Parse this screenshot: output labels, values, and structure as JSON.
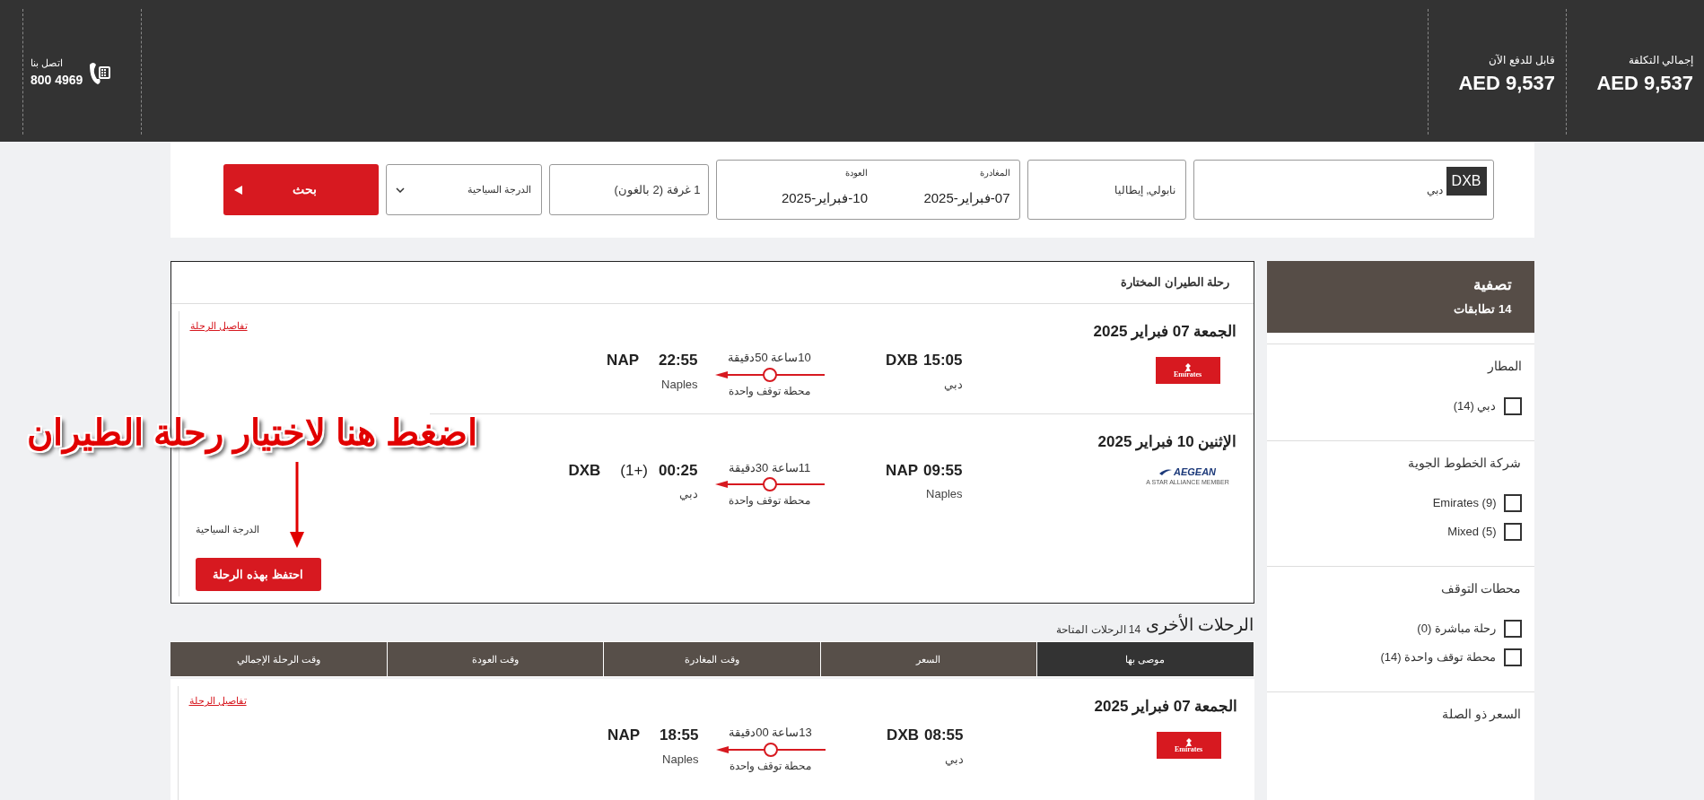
{
  "header": {
    "contact": {
      "label": "اتصل بنا",
      "phone": "800 4969"
    },
    "totals": [
      {
        "label": "إجمالي التكلفة",
        "amount": "AED 9,537"
      },
      {
        "label": "قابل للدفع الآن",
        "amount": "AED 9,537"
      }
    ]
  },
  "search": {
    "origin": {
      "code": "DXB",
      "city": "دبي"
    },
    "destination": "نابولي, إيطاليا",
    "departure": {
      "label": "المغادرة",
      "value": "07-فبراير-2025"
    },
    "return": {
      "label": "العودة",
      "value": "10-فبراير-2025"
    },
    "rooms": "1 غرفة (2 بالغون)",
    "cabin": "الدرجة السياحية",
    "button": "بحث"
  },
  "filters": {
    "title": "تصفية",
    "matches": "14 تطابقات",
    "sections": [
      {
        "title": "المطار",
        "options": [
          {
            "label": "دبي (14)",
            "checked": false
          }
        ]
      },
      {
        "title": "شركة الخطوط الجوية",
        "options": [
          {
            "label": "Emirates (9)",
            "checked": false
          },
          {
            "label": "Mixed (5)",
            "checked": false
          }
        ]
      },
      {
        "title": "محطات التوقف",
        "options": [
          {
            "label": "رحلة مباشرة (0)",
            "checked": false
          },
          {
            "label": "محطة توقف واحدة (14)",
            "checked": false
          }
        ]
      },
      {
        "title": "السعر ذو الصلة"
      }
    ]
  },
  "selected_flight": {
    "title": "رحلة الطيران المختارة",
    "details_link": "تفاصيل الرحلة",
    "cabin": "الدرجة السياحية",
    "book_button": "احتفظ بهذه الرحلة",
    "legs": [
      {
        "date": "الجمعة 07 فبراير 2025",
        "logo": {
          "kind": "emirates",
          "text": "Emirates"
        },
        "dep_time": "15:05",
        "dep_code": "DXB",
        "dep_city": "دبي",
        "duration": "10ساعة 50دقيقة",
        "stops": "محطة توقف واحدة",
        "arr_time": "22:55",
        "arr_code": "NAP",
        "arr_city": "Naples"
      },
      {
        "date": "الإثنين 10 فبراير 2025",
        "logo": {
          "kind": "aegean",
          "text": "AEGEAN",
          "tagline": "A STAR ALLIANCE MEMBER"
        },
        "dep_time": "09:55",
        "dep_code": "NAP",
        "dep_city": "Naples",
        "duration": "11ساعة 30دقيقة",
        "stops": "محطة توقف واحدة",
        "arr_time": "00:25",
        "next_day": "(1+)",
        "arr_code": "DXB",
        "arr_city": "دبي"
      }
    ]
  },
  "annotation": {
    "text": "اضغط هنا لاختيار رحلة الطيران"
  },
  "other_flights": {
    "title": "الرحلات الأخرى",
    "count": "14 الرحلات المتاحة",
    "tabs": [
      {
        "label": "موصى بها",
        "selected": true
      },
      {
        "label": "السعر",
        "selected": false
      },
      {
        "label": "وقت المغادرة",
        "selected": false
      },
      {
        "label": "وقت العودة",
        "selected": false
      },
      {
        "label": "وقت الرحلة الإجمالي",
        "selected": false
      }
    ],
    "flights": [
      {
        "details_link": "تفاصيل الرحلة",
        "legs": [
          {
            "date": "الجمعة 07 فبراير 2025",
            "logo": {
              "kind": "emirates",
              "text": "Emirates"
            },
            "dep_time": "08:55",
            "dep_code": "DXB",
            "dep_city": "دبي",
            "duration": "13ساعة 00دقيقة",
            "stops": "محطة توقف واحدة",
            "arr_time": "18:55",
            "arr_code": "NAP",
            "arr_city": "Naples"
          }
        ]
      }
    ]
  }
}
